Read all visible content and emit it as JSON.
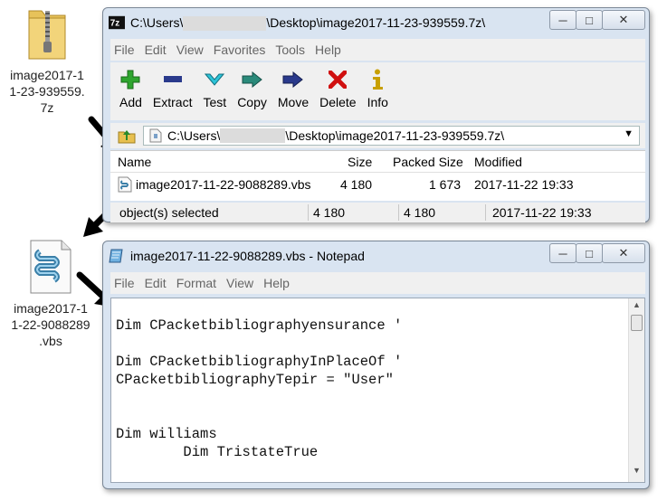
{
  "desktop": {
    "archive_icon_label": "image2017-1\n1-23-939559.\n7z",
    "script_icon_label": "image2017-1\n1-22-9088289\n.vbs"
  },
  "sevenzip": {
    "title_prefix": "C:\\Users\\",
    "title_suffix": "\\Desktop\\image2017-11-23-939559.7z\\",
    "menu": [
      "File",
      "Edit",
      "View",
      "Favorites",
      "Tools",
      "Help"
    ],
    "toolbar": {
      "add": "Add",
      "extract": "Extract",
      "test": "Test",
      "copy": "Copy",
      "move": "Move",
      "delete": "Delete",
      "info": "Info"
    },
    "address_prefix": "C:\\Users\\",
    "address_suffix": "\\Desktop\\image2017-11-23-939559.7z\\",
    "columns": {
      "name": "Name",
      "size": "Size",
      "packed": "Packed Size",
      "modified": "Modified"
    },
    "row": {
      "name": "image2017-11-22-9088289.vbs",
      "size": "4 180",
      "packed": "1 673",
      "modified": "2017-11-22 19:33"
    },
    "status": {
      "selected": "object(s) selected",
      "size": "4 180",
      "packed": "4 180",
      "modified": "2017-11-22 19:33"
    }
  },
  "notepad": {
    "title": "image2017-11-22-9088289.vbs - Notepad",
    "menu": [
      "File",
      "Edit",
      "Format",
      "View",
      "Help"
    ],
    "content": "Dim CPacketbibliographyensurance '\n\nDim CPacketbibliographyInPlaceOf '\nCPacketbibliographyTepir = \"User\"\n\n\nDim williams\n        Dim TristateTrue"
  },
  "colors": {
    "window_frame": "#d9e4f1",
    "add": "#2fa52f",
    "delete": "#d01010",
    "nav": "#2a3a8c",
    "info": "#c8a000"
  }
}
